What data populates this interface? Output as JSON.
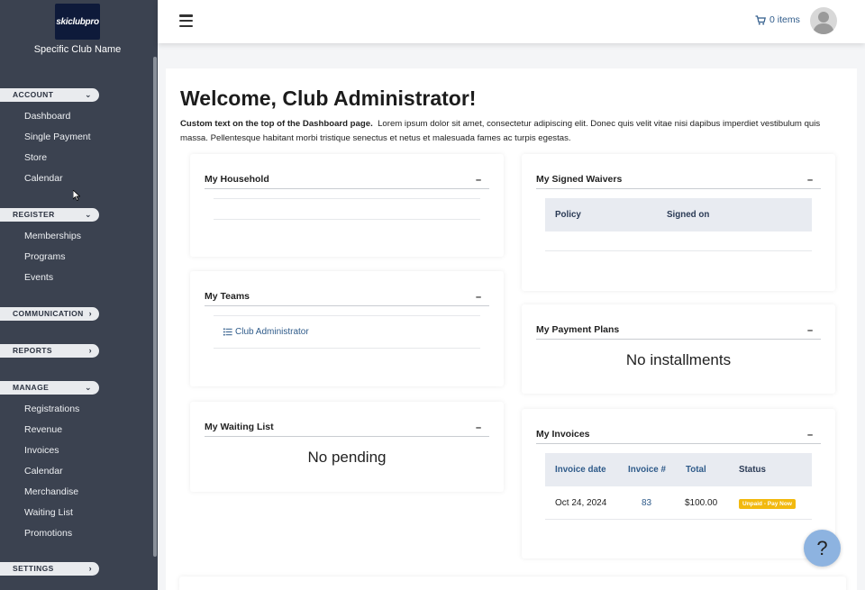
{
  "sidebar": {
    "logo_text": "skiclubpro",
    "club_name": "Specific Club Name",
    "sections": [
      {
        "label": "ACCOUNT",
        "chevron": "chevron-down",
        "items": [
          "Dashboard",
          "Single Payment",
          "Store",
          "Calendar"
        ]
      },
      {
        "label": "REGISTER",
        "chevron": "chevron-down",
        "items": [
          "Memberships",
          "Programs",
          "Events"
        ]
      },
      {
        "label": "COMMUNICATION",
        "chevron": "chevron-right",
        "items": []
      },
      {
        "label": "REPORTS",
        "chevron": "chevron-right",
        "items": []
      },
      {
        "label": "MANAGE",
        "chevron": "chevron-down",
        "items": [
          "Registrations",
          "Revenue",
          "Invoices",
          "Calendar",
          "Merchandise",
          "Waiting List",
          "Promotions"
        ]
      },
      {
        "label": "SETTINGS",
        "chevron": "chevron-right",
        "items": []
      }
    ]
  },
  "topbar": {
    "cart_label": "0 items"
  },
  "main": {
    "title": "Welcome, Club Administrator!",
    "intro_bold": "Custom text on the top of the Dashboard page.",
    "intro_text": "Lorem ipsum dolor sit amet, consectetur adipiscing elit. Donec quis velit vitae nisi dapibus imperdiet vestibulum quis massa. Pellentesque habitant morbi tristique senectus et netus et malesuada fames ac turpis egestas."
  },
  "cards": {
    "household": {
      "title": "My Household",
      "min": "–"
    },
    "teams": {
      "title": "My Teams",
      "min": "–",
      "team_link": "Club Administrator"
    },
    "waiting": {
      "title": "My Waiting List",
      "min": "–",
      "message": "No pending"
    },
    "waivers": {
      "title": "My Signed Waivers",
      "min": "–",
      "headers": [
        "Policy",
        "Signed on"
      ]
    },
    "payment_plans": {
      "title": "My Payment Plans",
      "min": "–",
      "message": "No installments"
    },
    "invoices": {
      "title": "My Invoices",
      "min": "–",
      "headers": [
        "Invoice date",
        "Invoice #",
        "Total",
        "Status"
      ],
      "rows": [
        {
          "date": "Oct 24, 2024",
          "number": "83",
          "total": "$100.00",
          "status": "Unpaid - Pay Now"
        }
      ]
    }
  },
  "help": {
    "label": "?"
  },
  "colors": {
    "sidebar_bg": "#3b4250",
    "link": "#2f5b8a",
    "status_unpaid": "#f2b90f",
    "help_button": "#8db3e0"
  }
}
